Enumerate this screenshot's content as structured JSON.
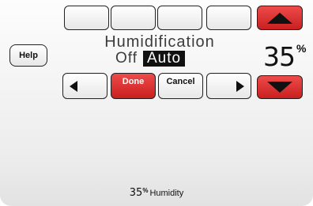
{
  "screen": {
    "title": "Humidification",
    "mode_options": {
      "off": "Off",
      "auto": "Auto"
    },
    "selected_mode": "Auto"
  },
  "buttons": {
    "help": "Help",
    "done": "Done",
    "cancel": "Cancel"
  },
  "setpoint": {
    "value": "35",
    "unit": "%"
  },
  "status": {
    "value": "35",
    "unit": "%",
    "label": "Humidity"
  },
  "colors": {
    "accent_red": "#d62b2b",
    "highlight_bg": "#111111"
  },
  "icons": {
    "up": "triangle-up-icon",
    "down": "triangle-down-icon",
    "left": "triangle-left-icon",
    "right": "triangle-right-icon"
  }
}
